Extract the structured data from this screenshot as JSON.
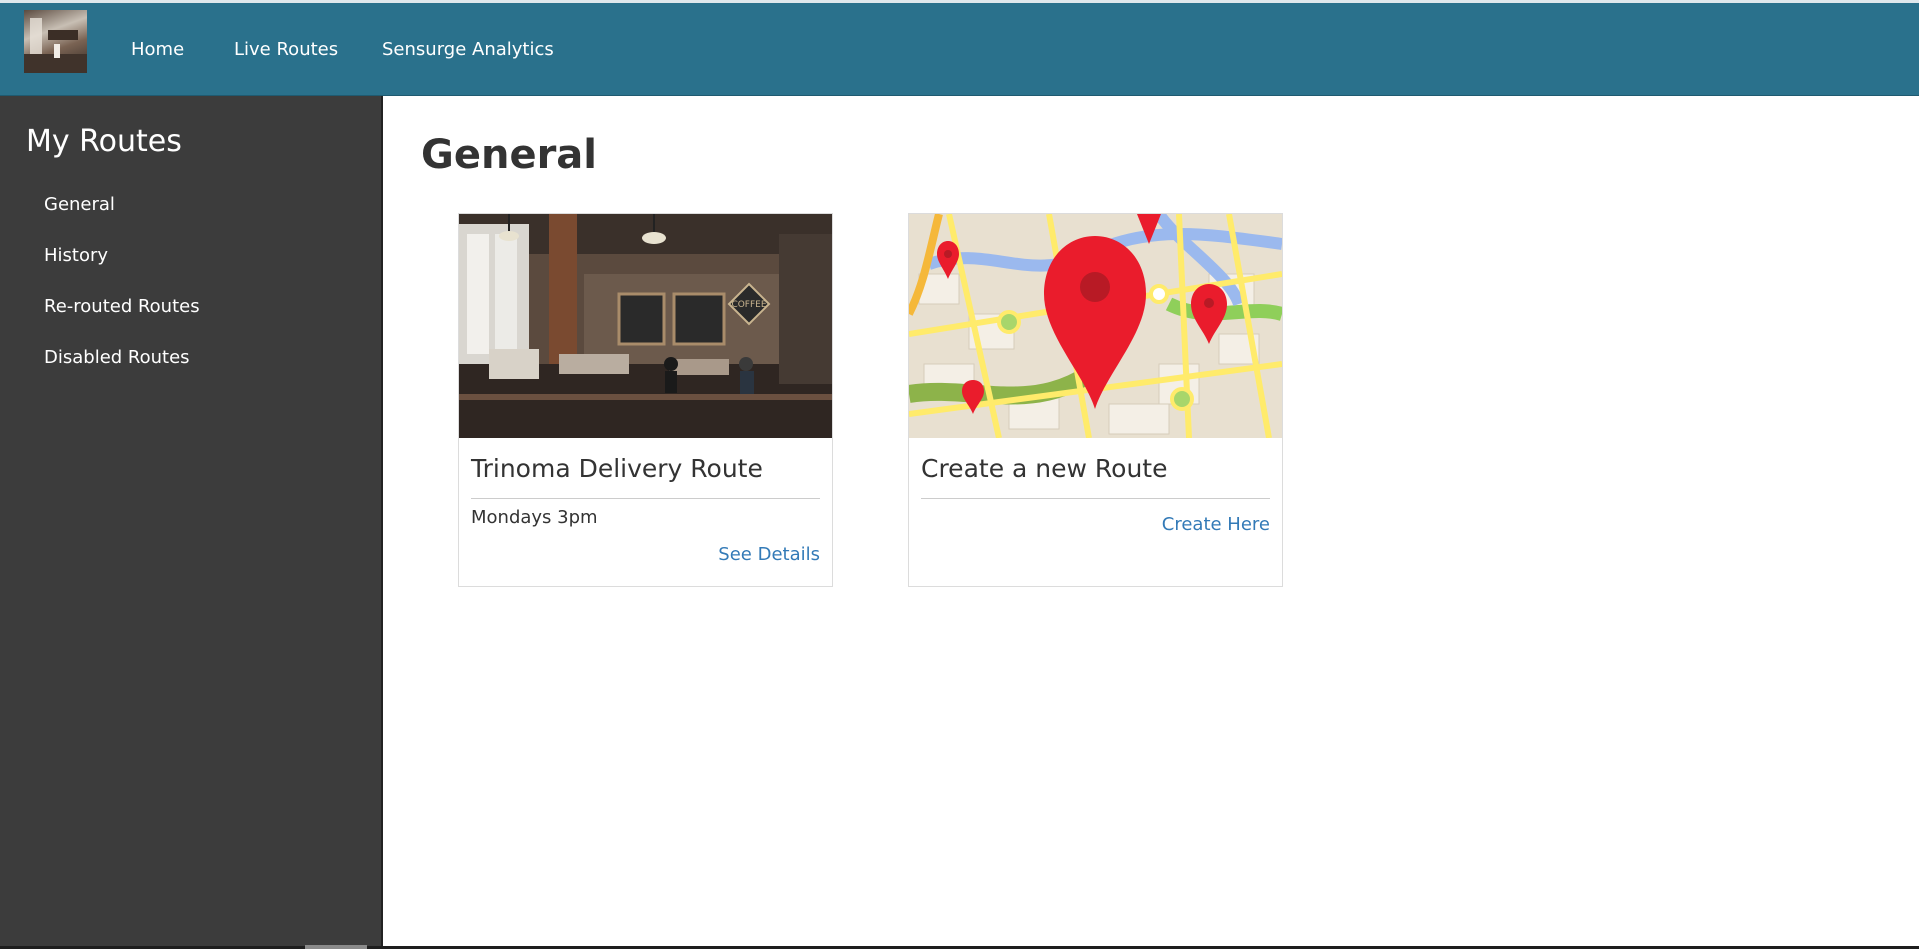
{
  "header": {
    "nav": [
      {
        "label": "Home"
      },
      {
        "label": "Live Routes"
      },
      {
        "label": "Sensurge Analytics"
      }
    ]
  },
  "sidebar": {
    "title": "My Routes",
    "items": [
      {
        "label": "General"
      },
      {
        "label": "History"
      },
      {
        "label": "Re-routed Routes"
      },
      {
        "label": "Disabled Routes"
      }
    ]
  },
  "main": {
    "title": "General",
    "cards": [
      {
        "title": "Trinoma Delivery Route",
        "subtitle": "Mondays 3pm",
        "link": "See Details",
        "image": "coffee-shop-photo",
        "sign_text": "COFFEE"
      },
      {
        "title": "Create a new Route",
        "subtitle": "",
        "link": "Create Here",
        "image": "map-with-pins"
      }
    ]
  },
  "colors": {
    "header": "#2a718c",
    "sidebar": "#3c3c3c",
    "link": "#337ab7",
    "pin": "#ea1c2c"
  }
}
